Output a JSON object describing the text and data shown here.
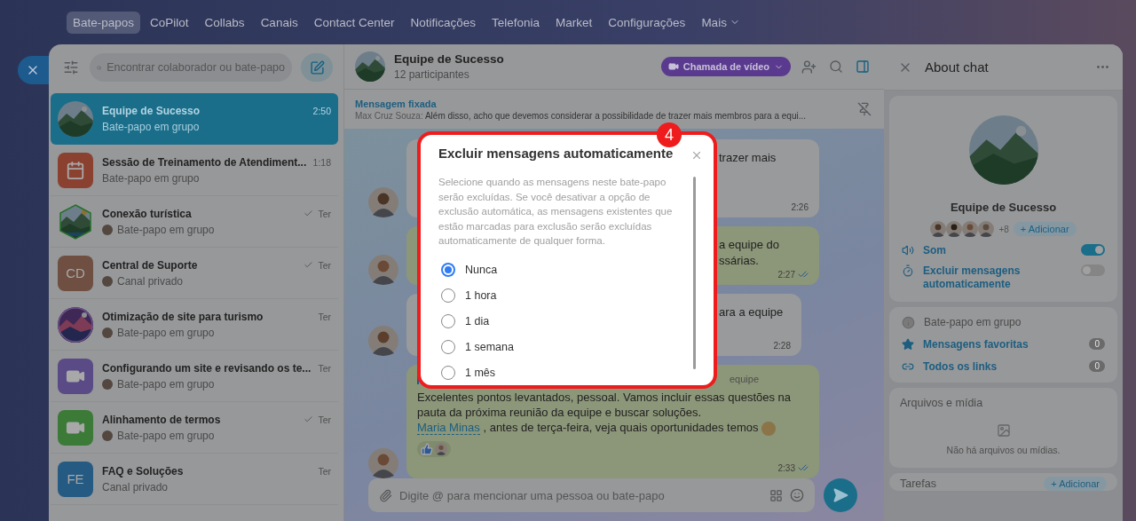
{
  "top_nav": {
    "items": [
      {
        "label": "Bate-papos",
        "selected": true
      },
      {
        "label": "CoPilot",
        "selected": false
      },
      {
        "label": "Collabs",
        "selected": false
      },
      {
        "label": "Canais",
        "selected": false
      },
      {
        "label": "Contact Center",
        "selected": false
      },
      {
        "label": "Notificações",
        "selected": false
      },
      {
        "label": "Telefonia",
        "selected": false
      },
      {
        "label": "Market",
        "selected": false
      },
      {
        "label": "Configurações",
        "selected": false
      }
    ],
    "more": "Mais"
  },
  "sidebar": {
    "search_placeholder": "Encontrar colaborador ou bate-papo",
    "chats": [
      {
        "title": "Equipe de Sucesso",
        "time": "2:50",
        "subtitle": "Bate-papo em grupo",
        "read": false,
        "sender_avatar": false,
        "selected": true
      },
      {
        "title": "Sessão de Treinamento de Atendiment...",
        "time": "1:18",
        "subtitle": "Bate-papo em grupo",
        "avatar": {
          "kind": "calendar",
          "color": "#8a4130"
        },
        "read": false,
        "sender_avatar": false,
        "selected": false
      },
      {
        "title": "Conexão turística",
        "time": "Ter",
        "subtitle": "Bate-papo em grupo",
        "avatar": {
          "kind": "hex-picture"
        },
        "read": true,
        "sender_avatar": true,
        "selected": false
      },
      {
        "title": "Central de Suporte",
        "time": "Ter",
        "subtitle": "Canal privado",
        "avatar": {
          "kind": "initials",
          "text": "CD",
          "color": "#6e4f42"
        },
        "read": true,
        "sender_avatar": true,
        "selected": false
      },
      {
        "title": "Otimização de site para turismo",
        "time": "Ter",
        "subtitle": "Bate-papo em grupo",
        "read": false,
        "sender_avatar": true,
        "selected": false
      },
      {
        "title": "Configurando um site e revisando os te...",
        "time": "Ter",
        "subtitle": "Bate-papo em grupo",
        "avatar": {
          "kind": "video",
          "color": "#5a4a86"
        },
        "read": false,
        "sender_avatar": true,
        "selected": false
      },
      {
        "title": "Alinhamento de termos",
        "time": "Ter",
        "subtitle": "Bate-papo em grupo",
        "avatar": {
          "kind": "video",
          "color": "#3b7a37"
        },
        "read": true,
        "sender_avatar": true,
        "selected": false
      },
      {
        "title": "FAQ e Soluções",
        "time": "Ter",
        "subtitle": "Canal privado",
        "avatar": {
          "kind": "initials",
          "text": "FE",
          "color": "#255a82"
        },
        "read": false,
        "sender_avatar": false,
        "selected": false
      }
    ]
  },
  "chat": {
    "title": "Equipe de Sucesso",
    "participants": "12 participantes",
    "call_button": "Chamada de vídeo",
    "pinned": {
      "label": "Mensagem fixada",
      "sender": "Max Cruz Souza:",
      "text": "Além disso, acho que devemos considerar a possibilidade de trazer mais membros para a equi..."
    },
    "messages": [
      {
        "kind": "incoming",
        "lines": [
          "trazer mais"
        ],
        "time": "2:26",
        "read": false
      },
      {
        "kind": "outgoing",
        "lines": [
          "a equipe do",
          "ssárias."
        ],
        "time": "2:27",
        "read": true
      },
      {
        "kind": "incoming",
        "lines": [
          "ara a equipe"
        ],
        "time": "2:28",
        "read": false
      },
      {
        "kind": "outgoing-full",
        "quote": "equipe",
        "text": "Excelentes pontos levantados, pessoal. Vamos incluir essas questões na pauta da próxima reunião da equipe e buscar soluções.",
        "mention": "Maria Minas",
        "after": ", antes de terça-feira, veja quais oportunidades temos",
        "time": "2:33",
        "read": true
      }
    ],
    "input_placeholder": "Digite @ para mencionar uma pessoa ou bate-papo"
  },
  "modal": {
    "badge": "4",
    "title": "Excluir mensagens automaticamente",
    "description": "Selecione quando as mensagens neste bate-papo serão excluídas. Se você desativar a opção de exclusão automática, as mensagens existentes que estão marcadas para exclusão serão excluídas automaticamente de qualquer forma.",
    "options": [
      {
        "label": "Nunca",
        "selected": true
      },
      {
        "label": "1 hora",
        "selected": false
      },
      {
        "label": "1 dia",
        "selected": false
      },
      {
        "label": "1 semana",
        "selected": false
      },
      {
        "label": "1 mês",
        "selected": false
      }
    ]
  },
  "about": {
    "title": "About chat",
    "name": "Equipe de Sucesso",
    "members_more": "+8",
    "add": "+ Adicionar",
    "settings": [
      {
        "kind": "sound",
        "label": "Som",
        "on": true
      },
      {
        "kind": "timer",
        "label": "Excluir mensagens automaticamente",
        "on": false
      }
    ],
    "info": "Bate-papo em grupo",
    "links": [
      {
        "kind": "star",
        "label": "Mensagens favoritas",
        "count": "0"
      },
      {
        "kind": "link",
        "label": "Todos os links",
        "count": "0"
      }
    ],
    "files_title": "Arquivos e mídia",
    "files_empty": "Não há arquivos ou mídias.",
    "tasks_title": "Tarefas",
    "tasks_add": "+ Adicionar"
  }
}
